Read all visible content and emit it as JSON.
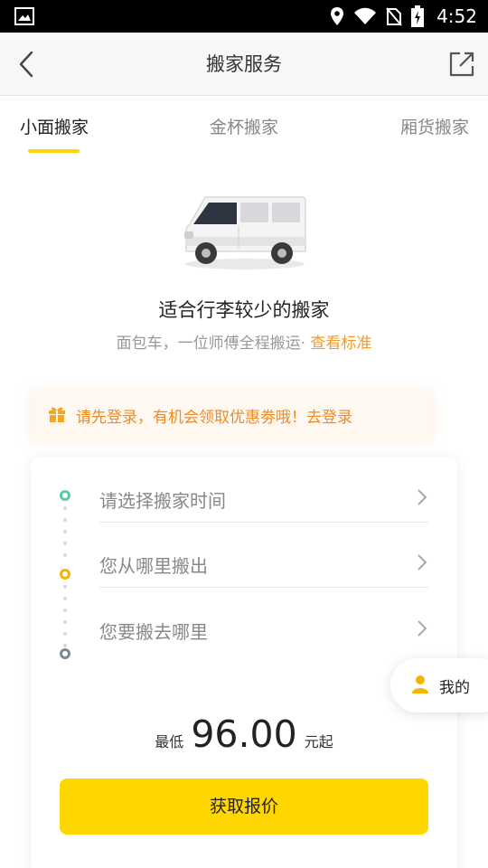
{
  "status_bar": {
    "time": "4:52",
    "icons": [
      "image-icon",
      "location-icon",
      "wifi-icon",
      "no-sim-icon",
      "battery-charging-icon"
    ]
  },
  "header": {
    "title": "搬家服务",
    "back_icon": "chevron-left-icon",
    "share_icon": "share-icon"
  },
  "tabs": [
    {
      "label": "小面搬家",
      "active": true
    },
    {
      "label": "金杯搬家",
      "active": false
    },
    {
      "label": "厢货搬家",
      "active": false
    }
  ],
  "vehicle": {
    "headline": "适合行李较少的搬家",
    "description": "面包车，一位师傅全程搬运·",
    "standard_link": "查看标准"
  },
  "notice": {
    "icon": "gift-icon",
    "text": "请先登录，有机会领取优惠劵哦！去登录"
  },
  "form": {
    "rows": [
      {
        "label": "请选择搬家时间"
      },
      {
        "label": "您从哪里搬出"
      },
      {
        "label": "您要搬去哪里"
      }
    ],
    "price_prefix": "最低",
    "price_value": "96.00",
    "price_suffix": "元起",
    "quote_button": "获取报价"
  },
  "floating": {
    "mine_label": "我的"
  },
  "colors": {
    "accent": "#ffd600",
    "orange": "#f08a24",
    "link": "#f59a23",
    "start_dot": "#5fc9a6",
    "mid_dot": "#f5b400",
    "end_dot": "#7a8a99"
  }
}
